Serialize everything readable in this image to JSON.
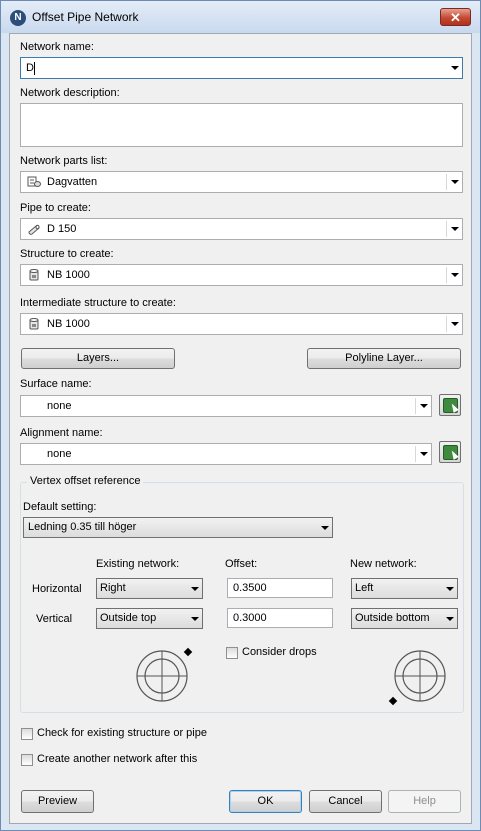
{
  "window": {
    "title": "Offset Pipe Network",
    "app_icon_letter": "N",
    "close_glyph": "✕"
  },
  "form": {
    "network_name_label": "Network name:",
    "network_name_value": "D",
    "network_description_label": "Network description:",
    "network_description_value": "",
    "parts_list_label": "Network parts list:",
    "parts_list_value": "Dagvatten",
    "pipe_label": "Pipe to create:",
    "pipe_value": "D 150",
    "structure_label": "Structure to create:",
    "structure_value": "NB 1000",
    "intermediate_label": "Intermediate structure to create:",
    "intermediate_value": "NB 1000",
    "layers_button": "Layers...",
    "polyline_layer_button": "Polyline Layer...",
    "surface_label": "Surface name:",
    "surface_value": "none",
    "alignment_label": "Alignment name:",
    "alignment_value": "none"
  },
  "vertex": {
    "group_title": "Vertex offset reference",
    "default_setting_label": "Default setting:",
    "default_setting_value": "Ledning 0.35 till höger",
    "existing_header": "Existing network:",
    "offset_header": "Offset:",
    "new_header": "New network:",
    "horizontal_label": "Horizontal",
    "vertical_label": "Vertical",
    "horizontal_existing": "Right",
    "horizontal_offset": "0.3500",
    "horizontal_new": "Left",
    "vertical_existing": "Outside top",
    "vertical_offset": "0.3000",
    "vertical_new": "Outside bottom",
    "consider_drops_label": "Consider drops",
    "consider_drops_checked": false
  },
  "options": {
    "check_existing_label": "Check for existing structure or pipe",
    "check_existing_checked": false,
    "create_another_label": "Create another network after this",
    "create_another_checked": false
  },
  "buttons": {
    "preview": "Preview",
    "ok": "OK",
    "cancel": "Cancel",
    "help": "Help"
  },
  "colors": {
    "title_gradient_top": "#e4edf8",
    "close_red": "#c44a33",
    "pick_green": "#3f8a3f",
    "focus_border": "#3d7bad"
  },
  "icons": {
    "app": "civil3d-network-icon",
    "parts_list": "parts-list-icon",
    "pipe": "pipe-icon",
    "structure": "structure-icon",
    "pick": "pick-from-drawing-icon"
  }
}
